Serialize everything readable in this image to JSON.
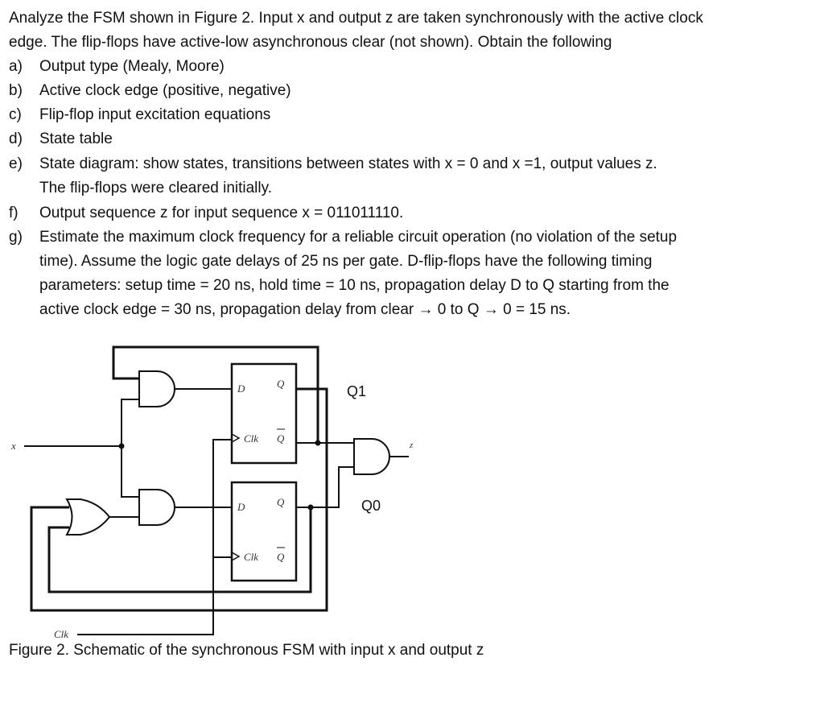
{
  "problem": {
    "intro_line1": "Analyze the FSM shown in Figure 2. Input x and output z are taken synchronously with the active clock",
    "intro_line2": "edge. The flip-flops have active-low asynchronous clear (not shown). Obtain the following",
    "items": [
      {
        "label": "a)",
        "lines": [
          "Output type (Mealy, Moore)"
        ]
      },
      {
        "label": "b)",
        "lines": [
          "Active clock edge (positive, negative)"
        ]
      },
      {
        "label": "c)",
        "lines": [
          "Flip-flop input excitation equations"
        ]
      },
      {
        "label": "d)",
        "lines": [
          "State table"
        ]
      },
      {
        "label": "e)",
        "lines": [
          "State diagram: show states, transitions between states with x = 0 and x =1, output values z.",
          "The flip-flops were cleared initially."
        ]
      },
      {
        "label": "f)",
        "lines": [
          "Output sequence z for input sequence x = 011011110."
        ]
      },
      {
        "label": "g)",
        "lines": [
          "Estimate the maximum clock frequency for a reliable circuit operation (no violation of the setup",
          "time). Assume the logic gate delays of 25 ns per gate.  D-flip-flops have the following timing",
          "parameters: setup time = 20 ns, hold time = 10 ns, propagation delay D to Q starting from the",
          "active clock edge =  30 ns, propagation delay from clear → 0 to Q → 0 =  15 ns."
        ]
      }
    ]
  },
  "schematic": {
    "input_label": "x",
    "output_label": "z",
    "clock_label": "Clk",
    "ff1": {
      "d": "D",
      "q": "Q",
      "clk": "Clk",
      "qbar": "Q",
      "state_label": "Q1"
    },
    "ff0": {
      "d": "D",
      "q": "Q",
      "clk": "Clk",
      "qbar": "Q",
      "state_label": "Q0"
    }
  },
  "caption": "Figure 2. Schematic of the synchronous FSM with input x and output z"
}
